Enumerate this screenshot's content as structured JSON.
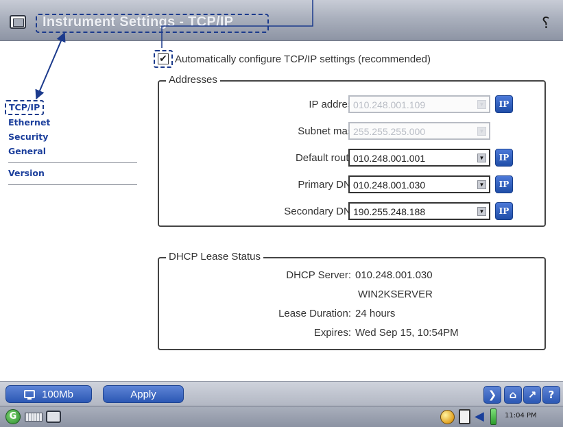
{
  "window": {
    "title": "Instrument Settings - TCP/IP",
    "help_icon": "whats-this-help-icon"
  },
  "nav": {
    "items": [
      {
        "label": "TCP/IP",
        "selected": true
      },
      {
        "label": "Ethernet",
        "selected": false
      },
      {
        "label": "Security",
        "selected": false
      },
      {
        "label": "General",
        "selected": false
      },
      {
        "label": "Version",
        "selected": false
      }
    ]
  },
  "auto_config": {
    "label": "Automatically configure TCP/IP settings (recommended)",
    "checked": true,
    "check_glyph": "✔"
  },
  "addresses": {
    "legend": "Addresses",
    "ip_button_label": "IP",
    "rows": [
      {
        "label": "IP address:",
        "value": "010.248.001.109",
        "enabled": false,
        "has_ip_button": true
      },
      {
        "label": "Subnet mask:",
        "value": "255.255.255.000",
        "enabled": false,
        "has_ip_button": false
      },
      {
        "label": "Default router:",
        "value": "010.248.001.001",
        "enabled": true,
        "has_ip_button": true
      },
      {
        "label": "Primary DNS:",
        "value": "010.248.001.030",
        "enabled": true,
        "has_ip_button": true
      },
      {
        "label": "Secondary DNS:",
        "value": "190.255.248.188",
        "enabled": true,
        "has_ip_button": true
      }
    ]
  },
  "dhcp": {
    "legend": "DHCP Lease Status",
    "server_label": "DHCP Server:",
    "server_ip": "010.248.001.030",
    "server_name": "WIN2KSERVER",
    "lease_label": "Lease Duration:",
    "lease_value": "24 hours",
    "expires_label": "Expires:",
    "expires_value": "Wed Sep 15, 10:54PM"
  },
  "toolbar": {
    "speed_label": "100Mb",
    "apply_label": "Apply",
    "nav_buttons": [
      {
        "name": "exit-icon",
        "glyph": "❯"
      },
      {
        "name": "home-icon",
        "glyph": "⌂"
      },
      {
        "name": "wrench-icon",
        "glyph": "↗"
      },
      {
        "name": "help-icon",
        "glyph": "?"
      }
    ]
  },
  "taskbar": {
    "start_glyph": "G",
    "speaker_glyph": "◀",
    "time": "11:04 PM"
  },
  "colors": {
    "accent_blue": "#2c58b4",
    "nav_link": "#1c3f9c",
    "annotation": "#1b3a8c"
  }
}
